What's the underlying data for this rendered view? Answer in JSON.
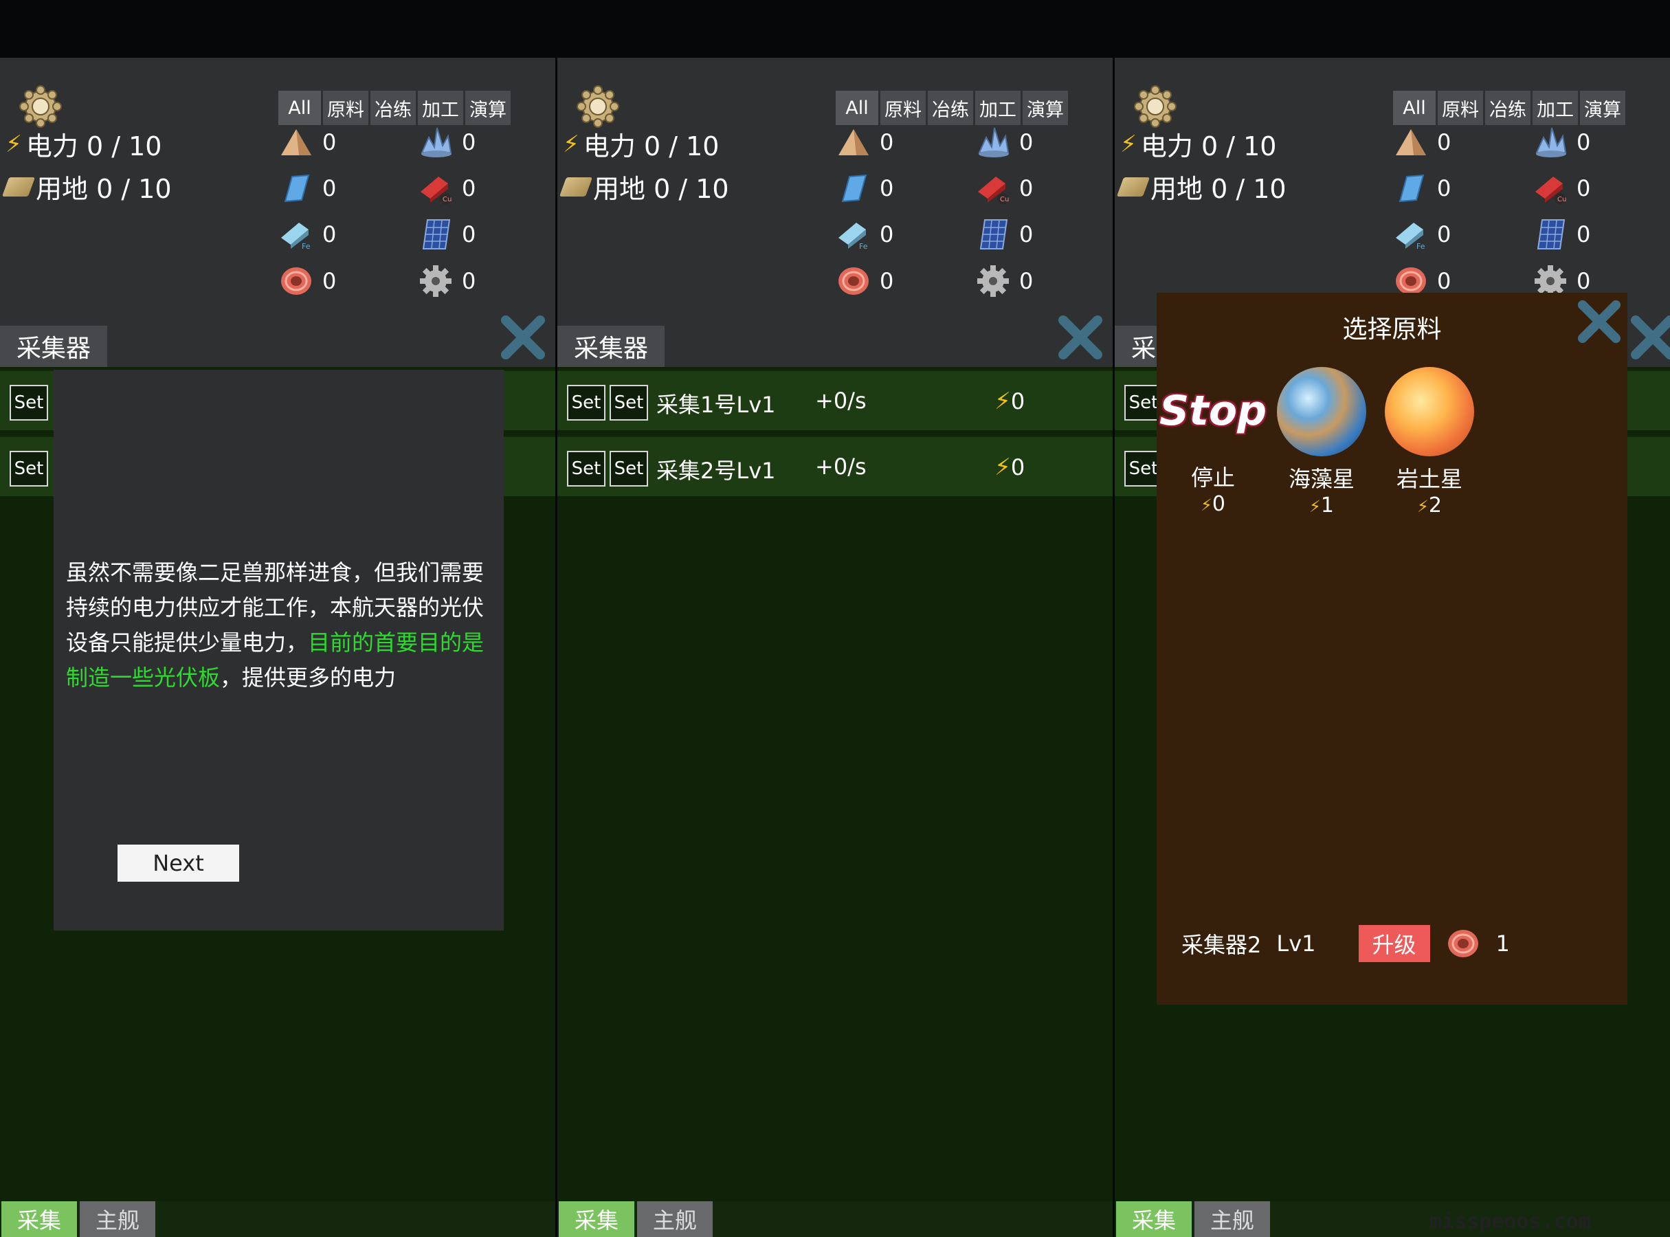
{
  "header": {
    "power_label": "电力 0 / 10",
    "land_label": "用地 0 / 10",
    "filters": [
      "All",
      "原料",
      "冶练",
      "加工",
      "演算"
    ],
    "resources": [
      {
        "icon": "sand-pile-icon",
        "count": "0"
      },
      {
        "icon": "crystal-ore-icon",
        "count": "0"
      },
      {
        "icon": "glass-plate-icon",
        "count": "0"
      },
      {
        "icon": "copper-ingot-icon",
        "count": "0"
      },
      {
        "icon": "iron-ingot-icon",
        "count": "0"
      },
      {
        "icon": "solar-panel-icon",
        "count": "0"
      },
      {
        "icon": "copper-coil-icon",
        "count": "0"
      },
      {
        "icon": "gear-part-icon",
        "count": "0"
      }
    ]
  },
  "section": {
    "title": "采集器",
    "title_short": "采"
  },
  "collectors": [
    {
      "set1": "Set",
      "set2": "Set",
      "name": "采集1号Lv1",
      "rate": "+0/s",
      "power": "0"
    },
    {
      "set1": "Set",
      "set2": "Set",
      "name": "采集2号Lv1",
      "rate": "+0/s",
      "power": "0"
    }
  ],
  "dialog": {
    "text_a": "虽然不需要像二足兽那样进食，但我们需要持续的电力供应才能工作，本航天器的光伏设备只能提供少量电力，",
    "text_highlight": "目前的首要目的是制造一些光伏板",
    "text_b": "，提供更多的电力",
    "next_label": "Next"
  },
  "modal": {
    "title": "选择原料",
    "choices": [
      {
        "display": "Stop",
        "name": "停止",
        "cost": "0"
      },
      {
        "name": "海藻星",
        "cost": "1"
      },
      {
        "name": "岩土星",
        "cost": "2"
      }
    ],
    "footer_name": "采集器2",
    "footer_level": "Lv1",
    "upgrade_label": "升级",
    "upgrade_cost": "1"
  },
  "nav": {
    "collect": "采集",
    "ship": "主舰"
  },
  "watermark": "misspeoos.com",
  "colors": {
    "accent_green": "#7ac35f",
    "highlight_text": "#2cdc2c",
    "upgrade_red": "#ee5a5a",
    "power_yellow": "#f3c21a",
    "close_blue": "#3f6e85"
  }
}
